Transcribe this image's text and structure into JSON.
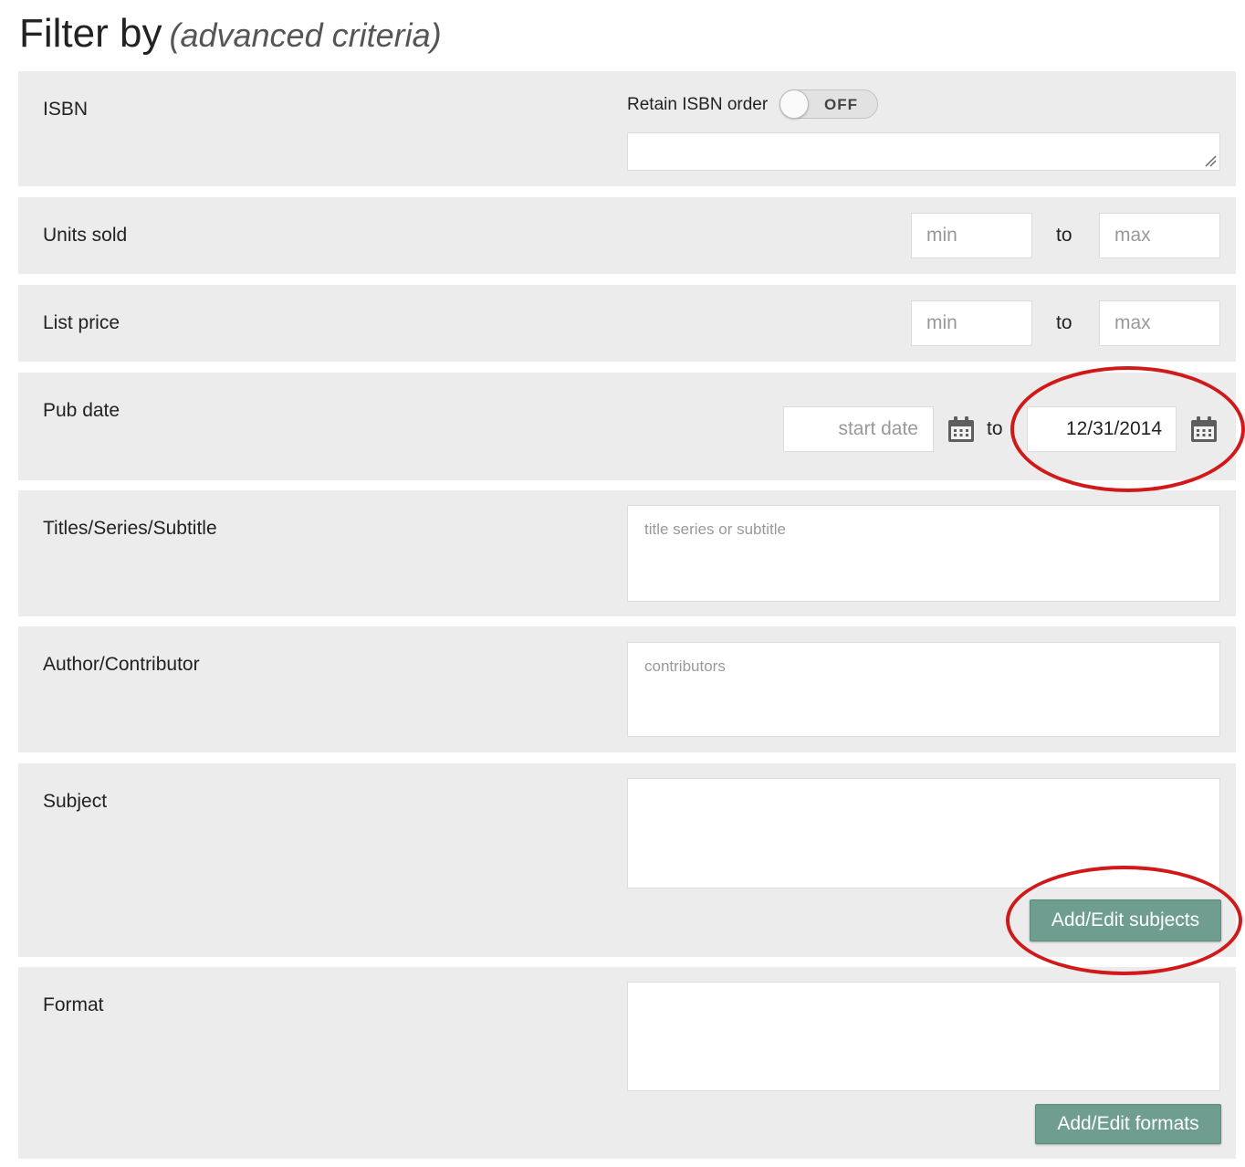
{
  "header": {
    "title": "Filter by",
    "subtitle": "(advanced criteria)"
  },
  "isbn": {
    "label": "ISBN",
    "retain_label": "Retain ISBN order",
    "toggle_state": "OFF",
    "value": ""
  },
  "units_sold": {
    "label": "Units sold",
    "min_placeholder": "min",
    "to": "to",
    "max_placeholder": "max"
  },
  "list_price": {
    "label": "List price",
    "min_placeholder": "min",
    "to": "to",
    "max_placeholder": "max"
  },
  "pub_date": {
    "label": "Pub date",
    "start_placeholder": "start date",
    "to": "to",
    "end_value": "12/31/2014"
  },
  "titles": {
    "label": "Titles/Series/Subtitle",
    "placeholder": "title series or subtitle"
  },
  "author": {
    "label": "Author/Contributor",
    "placeholder": "contributors"
  },
  "subject": {
    "label": "Subject",
    "button": "Add/Edit subjects"
  },
  "format": {
    "label": "Format",
    "button": "Add/Edit formats"
  },
  "colors": {
    "panel": "#ececec",
    "button": "#6f9e91",
    "highlight": "#d01a1a"
  }
}
